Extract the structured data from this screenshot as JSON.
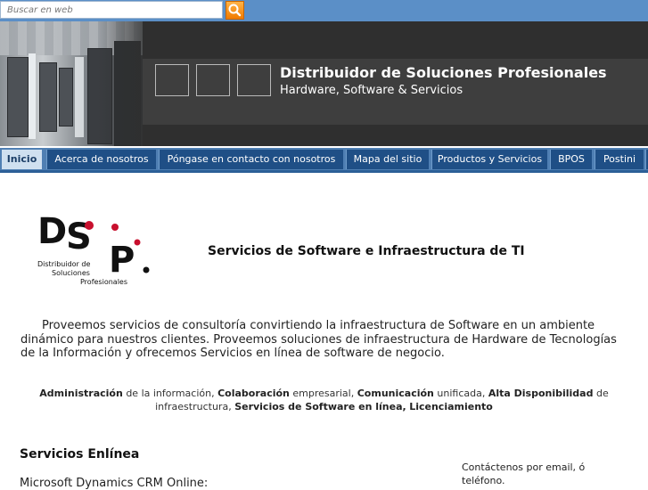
{
  "search": {
    "placeholder": "Buscar en web"
  },
  "header": {
    "title": "Distribuidor de Soluciones Profesionales",
    "subtitle": "Hardware, Software & Servicios"
  },
  "nav": {
    "items": [
      {
        "label": "Inicio",
        "active": true
      },
      {
        "label": "Acerca de nosotros"
      },
      {
        "label": "Póngase en contacto con nosotros"
      },
      {
        "label": "Mapa del sitio"
      },
      {
        "label": "Productos y Servicios"
      },
      {
        "label": "BPOS"
      },
      {
        "label": "Postini"
      }
    ]
  },
  "logo": {
    "initials": "DSP",
    "line1": "Distribuidor de",
    "line2": "Soluciones",
    "line3": "Profesionales"
  },
  "main": {
    "heading": "Servicios de Software e Infraestructura de TI",
    "intro": "Proveemos servicios de consultoría convirtiendo la infraestructura de Software en un ambiente dinámico para nuestros clientes. Proveemos soluciones de infraestructura de Hardware de Tecnologías de la Información y ofrecemos Servicios en línea de software de negocio.",
    "services": {
      "s1_bold": "Administración",
      "s1_text": " de la información, ",
      "s2_bold": "Colaboración",
      "s2_text": " empresarial, ",
      "s3_bold": "Comunicación",
      "s3_text": " unificada, ",
      "s4_bold": "Alta Disponibilidad",
      "s4_text": " de infraestructura, ",
      "s5_bold": "Servicios de Software en línea,",
      "s5_text": " ",
      "s6_bold": "Licenciamiento"
    },
    "section_title": "Servicios Enlínea",
    "first_item": "Microsoft Dynamics CRM Online:",
    "contact": "Contáctenos por email, ó teléfono."
  },
  "colors": {
    "topbar": "#5b8fc7",
    "nav": "#1f4f86",
    "nav_active": "#cfe0f0",
    "search_button": "#f07b00",
    "logo_red": "#c8102e"
  }
}
